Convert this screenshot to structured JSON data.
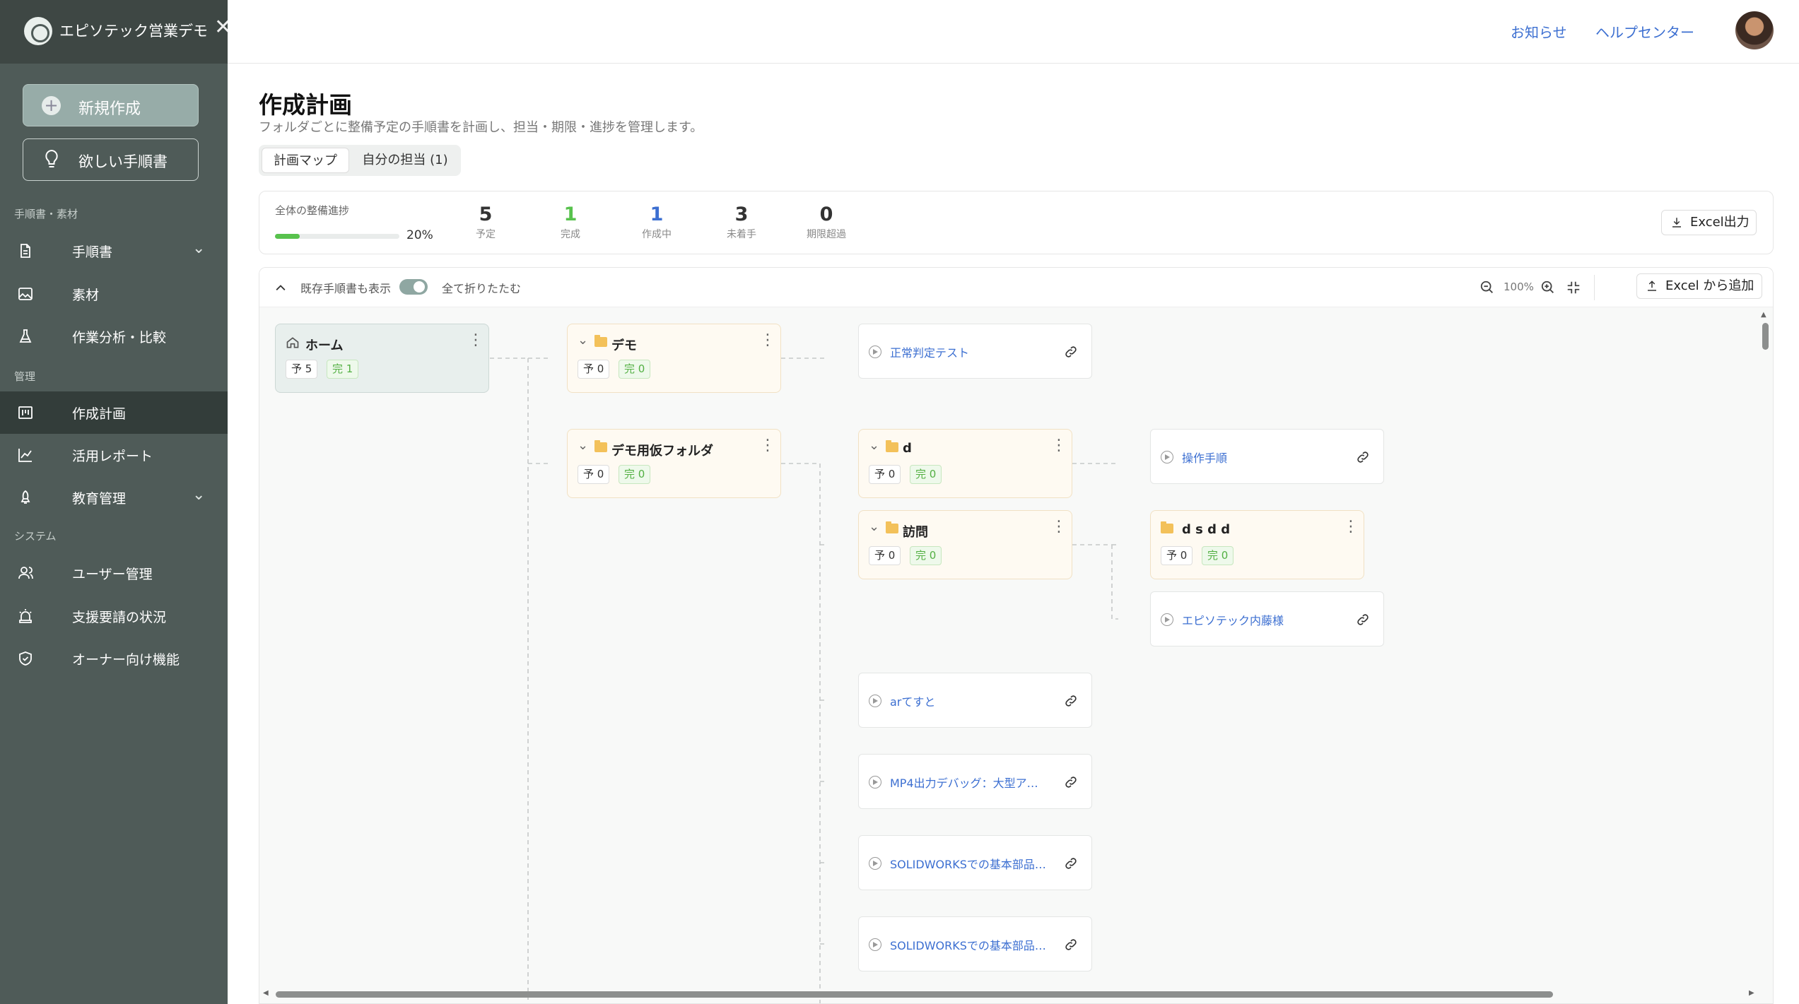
{
  "sidebar": {
    "org_name": "エピソテック営業デモ",
    "new_button": "新規作成",
    "want_button": "欲しい手順書",
    "sections": [
      "手順書・素材",
      "管理",
      "システム"
    ],
    "items": [
      {
        "label": "手順書"
      },
      {
        "label": "素材"
      },
      {
        "label": "作業分析・比較"
      },
      {
        "label": "作成計画"
      },
      {
        "label": "活用レポート"
      },
      {
        "label": "教育管理"
      },
      {
        "label": "ユーザー管理"
      },
      {
        "label": "支援要請の状況"
      },
      {
        "label": "オーナー向け機能"
      }
    ]
  },
  "topbar": {
    "notice": "お知らせ",
    "help": "ヘルプセンター"
  },
  "page": {
    "title": "作成計画",
    "description": "フォルダごとに整備予定の手順書を計画し、担当・期限・進捗を管理します。",
    "tabs": [
      "計画マップ",
      "自分の担当 (1)"
    ]
  },
  "stats": {
    "progress_label": "全体の整備進捗",
    "progress_fraction": 0.2,
    "progress_pct": "20%",
    "items": [
      {
        "value": "5",
        "label": "予定",
        "color": "#333333"
      },
      {
        "value": "1",
        "label": "完成",
        "color": "#58c24d"
      },
      {
        "value": "1",
        "label": "作成中",
        "color": "#3c6fd1"
      },
      {
        "value": "3",
        "label": "未着手",
        "color": "#333333"
      },
      {
        "value": "0",
        "label": "期限超過",
        "color": "#333333"
      }
    ],
    "excel_export": "Excel出力"
  },
  "map_toolbar": {
    "show_existing": "既存手順書も表示",
    "collapse_all": "全て折りたたむ",
    "zoom": "100%",
    "excel_add": "Excel から追加"
  },
  "nodes": {
    "home": {
      "name": "ホーム",
      "plan": "予 5",
      "done": "完 1"
    },
    "demo": {
      "name": "デモ",
      "plan": "予 0",
      "done": "完 0"
    },
    "demo_temp": {
      "name": "デモ用仮フォルダ",
      "plan": "予 0",
      "done": "完 0"
    },
    "d": {
      "name": "d",
      "plan": "予 0",
      "done": "完 0"
    },
    "visit": {
      "name": "訪問",
      "plan": "予 0",
      "done": "完 0"
    },
    "dsdd": {
      "name": "d s d d",
      "plan": "予 0",
      "done": "完 0"
    }
  },
  "docs": {
    "normal_test": "正常判定テスト",
    "operation": "操作手順",
    "episotec_naito": "エピソテック内藤様",
    "ar_test": "arてすと",
    "mp4_debug": "MP4出力デバッグ：大型ア…",
    "solidworks1": "SOLIDWORKSでの基本部品…",
    "solidworks2": "SOLIDWORKSでの基本部品…"
  }
}
